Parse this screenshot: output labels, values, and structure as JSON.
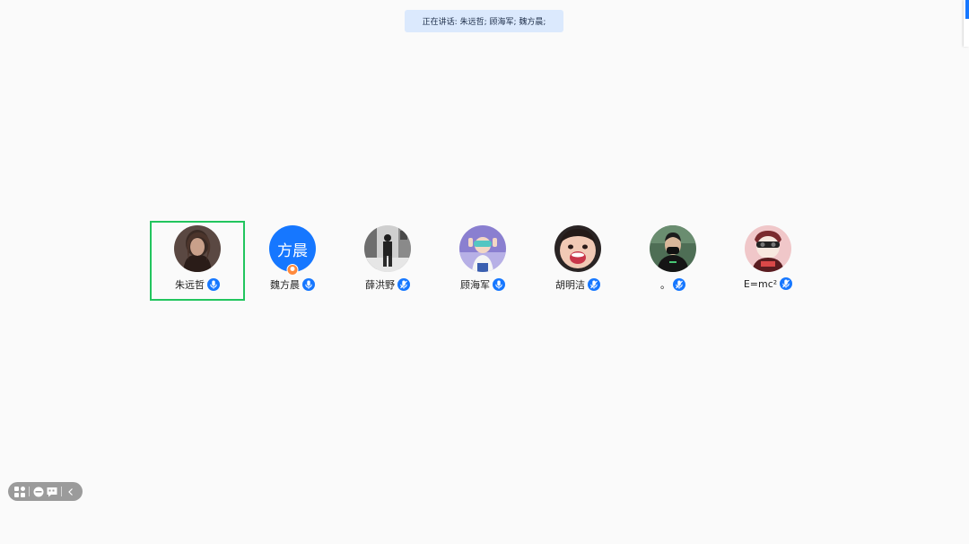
{
  "banner": {
    "label": "正在讲话:",
    "speakers": "朱远哲; 顾海军; 魏方晨;"
  },
  "participants": [
    {
      "name": "朱远哲",
      "avatar": "photo-portrait",
      "mic": "active",
      "active": true
    },
    {
      "name": "魏方晨",
      "avatar_text": "方晨",
      "avatar": "text-avatar",
      "mic": "active",
      "host": true
    },
    {
      "name": "薛洪野",
      "avatar": "photo-street",
      "mic": "muted"
    },
    {
      "name": "顾海军",
      "avatar": "photo-anime",
      "mic": "active"
    },
    {
      "name": "胡明洁",
      "avatar": "photo-baby",
      "mic": "muted"
    },
    {
      "name": "。",
      "avatar": "photo-man",
      "mic": "muted"
    },
    {
      "name": "E=mc²",
      "avatar": "photo-cartoon",
      "mic": "muted"
    }
  ],
  "toolbar": {
    "icons": [
      "grid-layout-icon",
      "emoji-icon",
      "chat-icon",
      "collapse-icon"
    ]
  },
  "colors": {
    "accent": "#1677ff",
    "active_border": "#22c55e",
    "banner_bg": "#dbe9fd",
    "host_badge": "#ff8a3d"
  }
}
